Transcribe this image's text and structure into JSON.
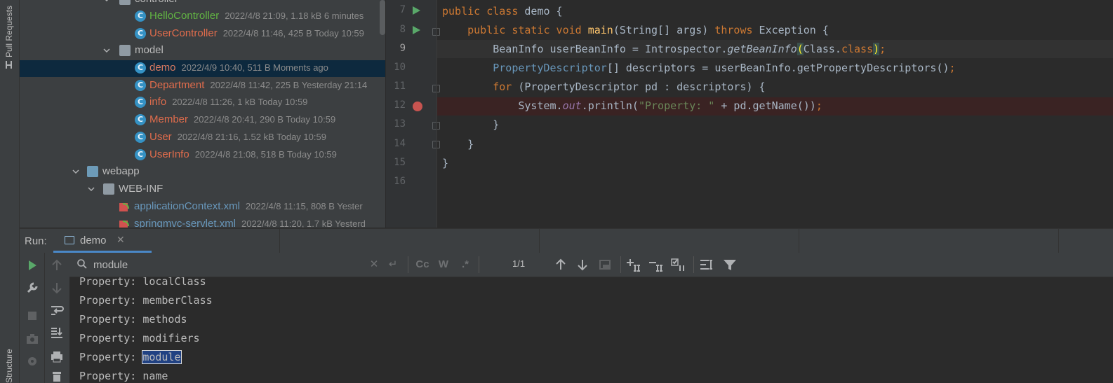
{
  "sidebar": {
    "pull_requests": "Pull Requests",
    "structure": "Structure"
  },
  "project_tree": {
    "rows": [
      {
        "name": "controller",
        "meta": "",
        "type": "folder"
      },
      {
        "name": "HelloController",
        "meta": "2022/4/8 21:09, 1.18 kB 6 minutes",
        "type": "class",
        "status": "added"
      },
      {
        "name": "UserController",
        "meta": "2022/4/8 11:46, 425 B Today 10:59",
        "type": "class",
        "status": "modified"
      },
      {
        "name": "model",
        "meta": "",
        "type": "folder"
      },
      {
        "name": "demo",
        "meta": "2022/4/9 10:40, 511 B Moments ago",
        "type": "class",
        "status": "modified",
        "selected": true
      },
      {
        "name": "Department",
        "meta": "2022/4/8 11:42, 225 B Yesterday 21:14",
        "type": "class",
        "status": "modified"
      },
      {
        "name": "info",
        "meta": "2022/4/8 11:26, 1 kB Today 10:59",
        "type": "class",
        "status": "modified"
      },
      {
        "name": "Member",
        "meta": "2022/4/8 20:41, 290 B Today 10:59",
        "type": "class",
        "status": "modified"
      },
      {
        "name": "User",
        "meta": "2022/4/8 21:16, 1.52 kB Today 10:59",
        "type": "class",
        "status": "modified"
      },
      {
        "name": "UserInfo",
        "meta": "2022/4/8 21:08, 518 B Today 10:59",
        "type": "class",
        "status": "modified"
      },
      {
        "name": "webapp",
        "meta": "",
        "type": "folder"
      },
      {
        "name": "WEB-INF",
        "meta": "",
        "type": "folder"
      },
      {
        "name": "applicationContext.xml",
        "meta": "2022/4/8 11:15, 808 B Yester",
        "type": "xml"
      },
      {
        "name": "springmvc-servlet.xml",
        "meta": "2022/4/8 11:20, 1.7 kB Yesterd",
        "type": "xml"
      }
    ]
  },
  "editor": {
    "line_numbers": [
      "7",
      "8",
      "9",
      "10",
      "11",
      "12",
      "13",
      "14",
      "15",
      "16"
    ],
    "code": {
      "l7_a": "public class ",
      "l7_b": "demo {",
      "l8_a": "    public static void ",
      "l8_fn": "main",
      "l8_b": "(String[] args) ",
      "l8_kw": "throws",
      "l8_c": " Exception {",
      "l9_a": "        BeanInfo userBeanInfo = Introspector.",
      "l9_it": "getBeanInfo",
      "l9_p1": "(",
      "l9_b": "Class.",
      "l9_kw": "class",
      "l9_p2": ")",
      "l9_semi": ";",
      "l10_cls": "        PropertyDescriptor",
      "l10_b": "[] descriptors = userBeanInfo.getPropertyDescriptors()",
      "l10_semi": ";",
      "l11_kw": "        for",
      "l11_b": " (PropertyDescriptor pd : descriptors) {",
      "l12_a": "            System.",
      "l12_out": "out",
      "l12_b": ".println(",
      "l12_str": "\"Property: \"",
      "l12_c": " + pd.getName())",
      "l12_semi": ";",
      "l13": "        }",
      "l14": "    }",
      "l15": "}",
      "l16": ""
    }
  },
  "run_window": {
    "label": "Run:",
    "tab": "demo",
    "search_value": "module",
    "match_count": "1/1",
    "btn_cc": "Cc",
    "btn_w": "W",
    "btn_regex": ".*",
    "console_prefix": "Property: ",
    "console_lines": [
      "localClass",
      "memberClass",
      "methods",
      "modifiers",
      "module",
      "name"
    ]
  }
}
